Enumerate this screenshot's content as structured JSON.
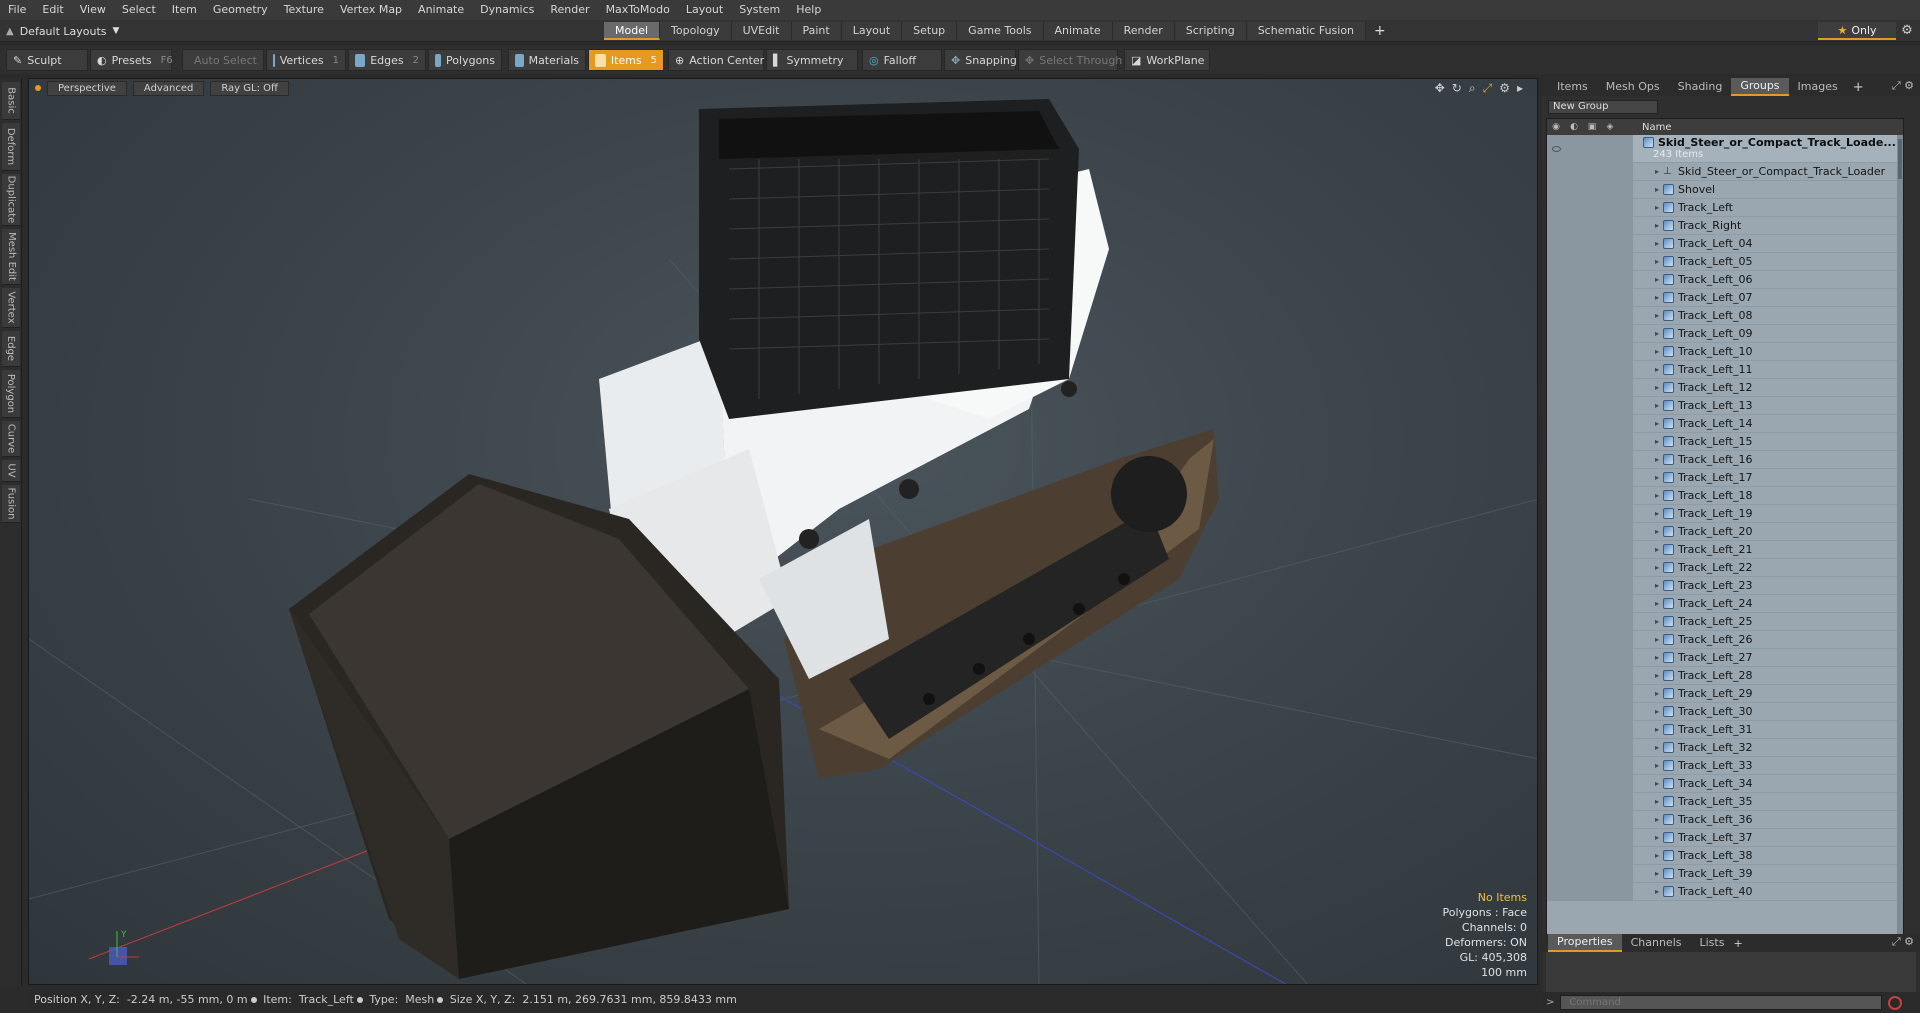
{
  "menu": [
    "File",
    "Edit",
    "View",
    "Select",
    "Item",
    "Geometry",
    "Texture",
    "Vertex Map",
    "Animate",
    "Dynamics",
    "Render",
    "MaxToModo",
    "Layout",
    "System",
    "Help"
  ],
  "layout": {
    "label": "Default Layouts"
  },
  "tabs": [
    {
      "label": "Model",
      "active": true
    },
    {
      "label": "Topology"
    },
    {
      "label": "UVEdit"
    },
    {
      "label": "Paint"
    },
    {
      "label": "Layout"
    },
    {
      "label": "Setup"
    },
    {
      "label": "Game Tools"
    },
    {
      "label": "Animate"
    },
    {
      "label": "Render"
    },
    {
      "label": "Scripting"
    },
    {
      "label": "Schematic Fusion"
    }
  ],
  "tab_add": "+",
  "only_label": "Only",
  "toolbar": {
    "sculpt": "Sculpt",
    "presets": "Presets",
    "presets_key": "F6",
    "auto_select": "Auto Select",
    "vertices": "Vertices",
    "vertices_key": "1",
    "edges": "Edges",
    "edges_key": "2",
    "polygons": "Polygons",
    "materials": "Materials",
    "items": "Items",
    "items_key": "5",
    "action_center": "Action Center",
    "symmetry": "Symmetry",
    "falloff": "Falloff",
    "snapping": "Snapping",
    "select_through": "Select Through",
    "workplane": "WorkPlane"
  },
  "left_tabs": [
    "Basic",
    "Deform",
    "Duplicate",
    "Mesh Edit",
    "Vertex",
    "Edge",
    "Polygon",
    "Curve",
    "UV",
    "Fusion"
  ],
  "viewport": {
    "view": "Perspective",
    "shading": "Advanced",
    "raygl": "Ray GL: Off",
    "info": {
      "no_items": "No Items",
      "polygons": "Polygons : Face",
      "channels": "Channels: 0",
      "deformers": "Deformers: ON",
      "gl": "GL: 405,308",
      "scale": "100 mm"
    },
    "axis_y": "Y"
  },
  "status": {
    "position_label": "Position X, Y, Z:",
    "position_value": "-2.24 m, -55 mm, 0 m",
    "item_label": "Item:",
    "item_value": "Track_Left",
    "type_label": "Type:",
    "type_value": "Mesh",
    "size_label": "Size X, Y, Z:",
    "size_value": "2.151 m, 269.7631 mm, 859.8433 mm"
  },
  "right_tabs": [
    {
      "label": "Items"
    },
    {
      "label": "Mesh Ops"
    },
    {
      "label": "Shading"
    },
    {
      "label": "Groups",
      "active": true
    },
    {
      "label": "Images"
    }
  ],
  "new_group": "New Group",
  "tree": {
    "name_header": "Name",
    "group_name": "Skid_Steer_or_Compact_Track_Loade...",
    "group_count": "243 Items",
    "locator": "Skid_Steer_or_Compact_Track_Loader",
    "items": [
      "Shovel",
      "Track_Left",
      "Track_Right",
      "Track_Left_04",
      "Track_Left_05",
      "Track_Left_06",
      "Track_Left_07",
      "Track_Left_08",
      "Track_Left_09",
      "Track_Left_10",
      "Track_Left_11",
      "Track_Left_12",
      "Track_Left_13",
      "Track_Left_14",
      "Track_Left_15",
      "Track_Left_16",
      "Track_Left_17",
      "Track_Left_18",
      "Track_Left_19",
      "Track_Left_20",
      "Track_Left_21",
      "Track_Left_22",
      "Track_Left_23",
      "Track_Left_24",
      "Track_Left_25",
      "Track_Left_26",
      "Track_Left_27",
      "Track_Left_28",
      "Track_Left_29",
      "Track_Left_30",
      "Track_Left_31",
      "Track_Left_32",
      "Track_Left_33",
      "Track_Left_34",
      "Track_Left_35",
      "Track_Left_36",
      "Track_Left_37",
      "Track_Left_38",
      "Track_Left_39",
      "Track_Left_40"
    ]
  },
  "props_tabs": [
    {
      "label": "Properties",
      "active": true
    },
    {
      "label": "Channels"
    },
    {
      "label": "Lists"
    }
  ],
  "command": {
    "placeholder": "Command",
    "prompt": ">"
  }
}
